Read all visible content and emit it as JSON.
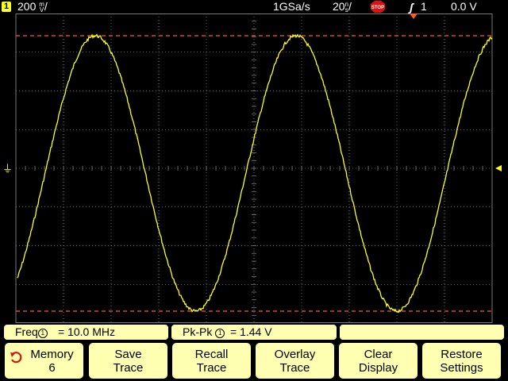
{
  "status": {
    "channel": "1",
    "volts_value": "200",
    "volts_unit_top": "m",
    "volts_unit_bottom": "V",
    "volts_suffix": "/",
    "sample_rate": "1GSa/s",
    "time_value": "20",
    "time_unit_top": "n",
    "time_unit_bottom": "s",
    "time_suffix": "/",
    "run_state": "STOP",
    "trigger_source": "1",
    "trigger_level": "0.0 V"
  },
  "measurements": {
    "freq_label": "Freq",
    "freq_channel": "1",
    "freq_value": "= 10.0 MHz",
    "pkpk_label": "Pk-Pk",
    "pkpk_channel": "1",
    "pkpk_value": "=  1.44  V"
  },
  "softkeys": [
    {
      "line1": "Memory",
      "line2": "6"
    },
    {
      "line1": "Save",
      "line2": "Trace"
    },
    {
      "line1": "Recall",
      "line2": "Trace"
    },
    {
      "line1": "Overlay",
      "line2": "Trace"
    },
    {
      "line1": "Clear",
      "line2": "Display"
    },
    {
      "line1": "Restore",
      "line2": "Settings"
    }
  ],
  "colors": {
    "trace": "#ffff1e",
    "cursor": "#ff5a28",
    "grid": "#7a7a7a",
    "softkey_bg": "#ffffb2"
  }
}
